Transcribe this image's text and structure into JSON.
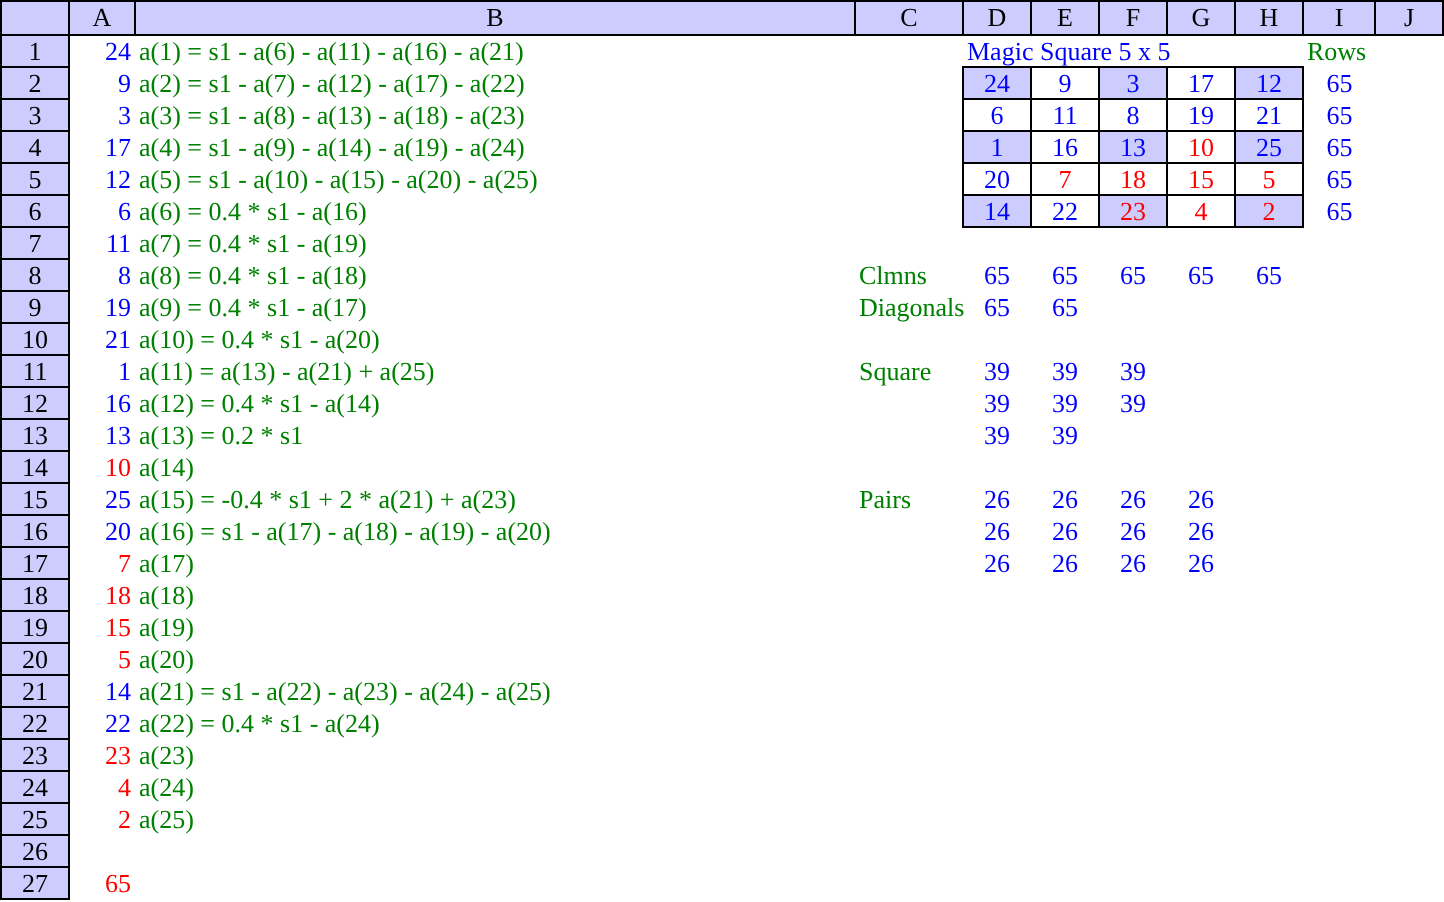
{
  "columns": [
    "A",
    "B",
    "C",
    "D",
    "E",
    "F",
    "G",
    "H",
    "I",
    "J"
  ],
  "rows": [
    {
      "number": "1",
      "cells": {
        "A": {
          "kind": "number",
          "text": "24",
          "color": "#0000ff"
        },
        "B": {
          "kind": "text",
          "text": "a(1) = s1 - a(6) - a(11) - a(16) - a(21)",
          "color": "#008000"
        },
        "D": {
          "kind": "text",
          "text": "Magic Square 5 x 5",
          "color": "#0000ff"
        },
        "I": {
          "kind": "text",
          "text": "Rows",
          "color": "#008000"
        }
      }
    },
    {
      "number": "2",
      "cells": {
        "A": {
          "kind": "number",
          "text": "9",
          "color": "#0000ff"
        },
        "B": {
          "kind": "text",
          "text": "a(2) = s1 - a(7) - a(12) - a(17) - a(22)",
          "color": "#008000"
        },
        "D": {
          "kind": "number",
          "text": "24",
          "color": "#0000ff",
          "boxed": true,
          "shaded": true
        },
        "E": {
          "kind": "number",
          "text": "9",
          "color": "#0000ff",
          "boxed": true,
          "shaded": false
        },
        "F": {
          "kind": "number",
          "text": "3",
          "color": "#0000ff",
          "boxed": true,
          "shaded": true
        },
        "G": {
          "kind": "number",
          "text": "17",
          "color": "#0000ff",
          "boxed": true,
          "shaded": false
        },
        "H": {
          "kind": "number",
          "text": "12",
          "color": "#0000ff",
          "boxed": true,
          "shaded": true
        },
        "I": {
          "kind": "number",
          "text": "65",
          "color": "#0000ff"
        }
      }
    },
    {
      "number": "3",
      "cells": {
        "A": {
          "kind": "number",
          "text": "3",
          "color": "#0000ff"
        },
        "B": {
          "kind": "text",
          "text": "a(3) = s1 - a(8) - a(13) - a(18) - a(23)",
          "color": "#008000"
        },
        "D": {
          "kind": "number",
          "text": "6",
          "color": "#0000ff",
          "boxed": true,
          "shaded": false
        },
        "E": {
          "kind": "number",
          "text": "11",
          "color": "#0000ff",
          "boxed": true,
          "shaded": false
        },
        "F": {
          "kind": "number",
          "text": "8",
          "color": "#0000ff",
          "boxed": true,
          "shaded": false
        },
        "G": {
          "kind": "number",
          "text": "19",
          "color": "#0000ff",
          "boxed": true,
          "shaded": false
        },
        "H": {
          "kind": "number",
          "text": "21",
          "color": "#0000ff",
          "boxed": true,
          "shaded": false
        },
        "I": {
          "kind": "number",
          "text": "65",
          "color": "#0000ff"
        }
      }
    },
    {
      "number": "4",
      "cells": {
        "A": {
          "kind": "number",
          "text": "17",
          "color": "#0000ff"
        },
        "B": {
          "kind": "text",
          "text": "a(4) = s1 - a(9) - a(14) - a(19) - a(24)",
          "color": "#008000"
        },
        "D": {
          "kind": "number",
          "text": "1",
          "color": "#0000ff",
          "boxed": true,
          "shaded": true
        },
        "E": {
          "kind": "number",
          "text": "16",
          "color": "#0000ff",
          "boxed": true,
          "shaded": false
        },
        "F": {
          "kind": "number",
          "text": "13",
          "color": "#0000ff",
          "boxed": true,
          "shaded": true
        },
        "G": {
          "kind": "number",
          "text": "10",
          "color": "#ff0000",
          "boxed": true,
          "shaded": false
        },
        "H": {
          "kind": "number",
          "text": "25",
          "color": "#0000ff",
          "boxed": true,
          "shaded": true
        },
        "I": {
          "kind": "number",
          "text": "65",
          "color": "#0000ff"
        }
      }
    },
    {
      "number": "5",
      "cells": {
        "A": {
          "kind": "number",
          "text": "12",
          "color": "#0000ff"
        },
        "B": {
          "kind": "text",
          "text": "a(5) = s1 - a(10) - a(15) - a(20) - a(25)",
          "color": "#008000"
        },
        "D": {
          "kind": "number",
          "text": "20",
          "color": "#0000ff",
          "boxed": true,
          "shaded": false
        },
        "E": {
          "kind": "number",
          "text": "7",
          "color": "#ff0000",
          "boxed": true,
          "shaded": false
        },
        "F": {
          "kind": "number",
          "text": "18",
          "color": "#ff0000",
          "boxed": true,
          "shaded": false
        },
        "G": {
          "kind": "number",
          "text": "15",
          "color": "#ff0000",
          "boxed": true,
          "shaded": false
        },
        "H": {
          "kind": "number",
          "text": "5",
          "color": "#ff0000",
          "boxed": true,
          "shaded": false
        },
        "I": {
          "kind": "number",
          "text": "65",
          "color": "#0000ff"
        }
      }
    },
    {
      "number": "6",
      "cells": {
        "A": {
          "kind": "number",
          "text": "6",
          "color": "#0000ff"
        },
        "B": {
          "kind": "text",
          "text": "a(6) = 0.4 * s1 - a(16)",
          "color": "#008000"
        },
        "D": {
          "kind": "number",
          "text": "14",
          "color": "#0000ff",
          "boxed": true,
          "shaded": true
        },
        "E": {
          "kind": "number",
          "text": "22",
          "color": "#0000ff",
          "boxed": true,
          "shaded": false
        },
        "F": {
          "kind": "number",
          "text": "23",
          "color": "#ff0000",
          "boxed": true,
          "shaded": true
        },
        "G": {
          "kind": "number",
          "text": "4",
          "color": "#ff0000",
          "boxed": true,
          "shaded": false
        },
        "H": {
          "kind": "number",
          "text": "2",
          "color": "#ff0000",
          "boxed": true,
          "shaded": true
        },
        "I": {
          "kind": "number",
          "text": "65",
          "color": "#0000ff"
        }
      }
    },
    {
      "number": "7",
      "cells": {
        "A": {
          "kind": "number",
          "text": "11",
          "color": "#0000ff"
        },
        "B": {
          "kind": "text",
          "text": "a(7) = 0.4 * s1 - a(19)",
          "color": "#008000"
        }
      }
    },
    {
      "number": "8",
      "cells": {
        "A": {
          "kind": "number",
          "text": "8",
          "color": "#0000ff"
        },
        "B": {
          "kind": "text",
          "text": "a(8) = 0.4 * s1 - a(18)",
          "color": "#008000"
        },
        "C": {
          "kind": "text",
          "text": "Clmns",
          "color": "#008000"
        },
        "D": {
          "kind": "number",
          "text": "65",
          "color": "#0000ff"
        },
        "E": {
          "kind": "number",
          "text": "65",
          "color": "#0000ff"
        },
        "F": {
          "kind": "number",
          "text": "65",
          "color": "#0000ff"
        },
        "G": {
          "kind": "number",
          "text": "65",
          "color": "#0000ff"
        },
        "H": {
          "kind": "number",
          "text": "65",
          "color": "#0000ff"
        }
      }
    },
    {
      "number": "9",
      "cells": {
        "A": {
          "kind": "number",
          "text": "19",
          "color": "#0000ff"
        },
        "B": {
          "kind": "text",
          "text": "a(9) = 0.4 * s1 - a(17)",
          "color": "#008000"
        },
        "C": {
          "kind": "text",
          "text": "Diagonals",
          "color": "#008000"
        },
        "D": {
          "kind": "number",
          "text": "65",
          "color": "#0000ff"
        },
        "E": {
          "kind": "number",
          "text": "65",
          "color": "#0000ff"
        }
      }
    },
    {
      "number": "10",
      "cells": {
        "A": {
          "kind": "number",
          "text": "21",
          "color": "#0000ff"
        },
        "B": {
          "kind": "text",
          "text": "a(10) = 0.4 * s1 - a(20)",
          "color": "#008000"
        }
      }
    },
    {
      "number": "11",
      "cells": {
        "A": {
          "kind": "number",
          "text": "1",
          "color": "#0000ff"
        },
        "B": {
          "kind": "text",
          "text": "a(11) = a(13) - a(21) + a(25)",
          "color": "#008000"
        },
        "C": {
          "kind": "text",
          "text": "Square",
          "color": "#008000"
        },
        "D": {
          "kind": "number",
          "text": "39",
          "color": "#0000ff"
        },
        "E": {
          "kind": "number",
          "text": "39",
          "color": "#0000ff"
        },
        "F": {
          "kind": "number",
          "text": "39",
          "color": "#0000ff"
        }
      }
    },
    {
      "number": "12",
      "cells": {
        "A": {
          "kind": "number",
          "text": "16",
          "color": "#0000ff"
        },
        "B": {
          "kind": "text",
          "text": "a(12) = 0.4 * s1 - a(14)",
          "color": "#008000"
        },
        "D": {
          "kind": "number",
          "text": "39",
          "color": "#0000ff"
        },
        "E": {
          "kind": "number",
          "text": "39",
          "color": "#0000ff"
        },
        "F": {
          "kind": "number",
          "text": "39",
          "color": "#0000ff"
        }
      }
    },
    {
      "number": "13",
      "cells": {
        "A": {
          "kind": "number",
          "text": "13",
          "color": "#0000ff"
        },
        "B": {
          "kind": "text",
          "text": "a(13) = 0.2 * s1",
          "color": "#008000"
        },
        "D": {
          "kind": "number",
          "text": "39",
          "color": "#0000ff"
        },
        "E": {
          "kind": "number",
          "text": "39",
          "color": "#0000ff"
        }
      }
    },
    {
      "number": "14",
      "cells": {
        "A": {
          "kind": "number",
          "text": "10",
          "color": "#ff0000"
        },
        "B": {
          "kind": "text",
          "text": "a(14)",
          "color": "#008000"
        }
      }
    },
    {
      "number": "15",
      "cells": {
        "A": {
          "kind": "number",
          "text": "25",
          "color": "#0000ff"
        },
        "B": {
          "kind": "text",
          "text": "a(15) = -0.4 * s1 + 2 * a(21) + a(23)",
          "color": "#008000"
        },
        "C": {
          "kind": "text",
          "text": "Pairs",
          "color": "#008000"
        },
        "D": {
          "kind": "number",
          "text": "26",
          "color": "#0000ff"
        },
        "E": {
          "kind": "number",
          "text": "26",
          "color": "#0000ff"
        },
        "F": {
          "kind": "number",
          "text": "26",
          "color": "#0000ff"
        },
        "G": {
          "kind": "number",
          "text": "26",
          "color": "#0000ff"
        }
      }
    },
    {
      "number": "16",
      "cells": {
        "A": {
          "kind": "number",
          "text": "20",
          "color": "#0000ff"
        },
        "B": {
          "kind": "text",
          "text": "a(16) = s1 - a(17) - a(18) - a(19) - a(20)",
          "color": "#008000"
        },
        "D": {
          "kind": "number",
          "text": "26",
          "color": "#0000ff"
        },
        "E": {
          "kind": "number",
          "text": "26",
          "color": "#0000ff"
        },
        "F": {
          "kind": "number",
          "text": "26",
          "color": "#0000ff"
        },
        "G": {
          "kind": "number",
          "text": "26",
          "color": "#0000ff"
        }
      }
    },
    {
      "number": "17",
      "cells": {
        "A": {
          "kind": "number",
          "text": "7",
          "color": "#ff0000"
        },
        "B": {
          "kind": "text",
          "text": "a(17)",
          "color": "#008000"
        },
        "D": {
          "kind": "number",
          "text": "26",
          "color": "#0000ff"
        },
        "E": {
          "kind": "number",
          "text": "26",
          "color": "#0000ff"
        },
        "F": {
          "kind": "number",
          "text": "26",
          "color": "#0000ff"
        },
        "G": {
          "kind": "number",
          "text": "26",
          "color": "#0000ff"
        }
      }
    },
    {
      "number": "18",
      "cells": {
        "A": {
          "kind": "number",
          "text": "18",
          "color": "#ff0000"
        },
        "B": {
          "kind": "text",
          "text": "a(18)",
          "color": "#008000"
        }
      }
    },
    {
      "number": "19",
      "cells": {
        "A": {
          "kind": "number",
          "text": "15",
          "color": "#ff0000"
        },
        "B": {
          "kind": "text",
          "text": "a(19)",
          "color": "#008000"
        }
      }
    },
    {
      "number": "20",
      "cells": {
        "A": {
          "kind": "number",
          "text": "5",
          "color": "#ff0000"
        },
        "B": {
          "kind": "text",
          "text": "a(20)",
          "color": "#008000"
        }
      }
    },
    {
      "number": "21",
      "cells": {
        "A": {
          "kind": "number",
          "text": "14",
          "color": "#0000ff"
        },
        "B": {
          "kind": "text",
          "text": "a(21) = s1 - a(22) - a(23) - a(24) - a(25)",
          "color": "#008000"
        }
      }
    },
    {
      "number": "22",
      "cells": {
        "A": {
          "kind": "number",
          "text": "22",
          "color": "#0000ff"
        },
        "B": {
          "kind": "text",
          "text": "a(22) = 0.4 * s1 - a(24)",
          "color": "#008000"
        }
      }
    },
    {
      "number": "23",
      "cells": {
        "A": {
          "kind": "number",
          "text": "23",
          "color": "#ff0000"
        },
        "B": {
          "kind": "text",
          "text": "a(23)",
          "color": "#008000"
        }
      }
    },
    {
      "number": "24",
      "cells": {
        "A": {
          "kind": "number",
          "text": "4",
          "color": "#ff0000"
        },
        "B": {
          "kind": "text",
          "text": "a(24)",
          "color": "#008000"
        }
      }
    },
    {
      "number": "25",
      "cells": {
        "A": {
          "kind": "number",
          "text": "2",
          "color": "#ff0000"
        },
        "B": {
          "kind": "text",
          "text": "a(25)",
          "color": "#008000"
        }
      }
    },
    {
      "number": "26",
      "cells": {}
    },
    {
      "number": "27",
      "cells": {
        "A": {
          "kind": "number",
          "text": "65",
          "color": "#ff0000"
        }
      }
    }
  ]
}
